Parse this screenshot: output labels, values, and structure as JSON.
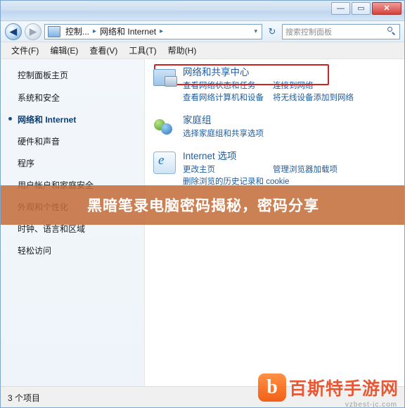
{
  "window": {
    "buttons": {
      "minimize": "—",
      "maximize": "▭",
      "close": "✕"
    }
  },
  "address": {
    "back": "◀",
    "forward": "▶",
    "crumbs": [
      "控制...",
      "网络和 Internet"
    ],
    "separator": "▸",
    "dropdown": "▾",
    "refresh": "↻",
    "search_placeholder": "搜索控制面板",
    "search_icon": "search-icon"
  },
  "menu": {
    "items": [
      "文件(F)",
      "编辑(E)",
      "查看(V)",
      "工具(T)",
      "帮助(H)"
    ]
  },
  "sidebar": {
    "title": "控制面板主页",
    "items": [
      {
        "label": "系统和安全",
        "current": false
      },
      {
        "label": "网络和 Internet",
        "current": true
      },
      {
        "label": "硬件和声音",
        "current": false
      },
      {
        "label": "程序",
        "current": false
      },
      {
        "label": "用户帐户和家庭安全",
        "current": false
      },
      {
        "label": "外观和个性化",
        "current": false
      },
      {
        "label": "时钟、语言和区域",
        "current": false
      },
      {
        "label": "轻松访问",
        "current": false
      }
    ]
  },
  "main": {
    "groups": [
      {
        "icon": "network-sharing-icon",
        "title": "网络和共享中心",
        "links": [
          [
            "查看网络状态和任务",
            "连接到网络"
          ],
          [
            "查看网络计算机和设备",
            "将无线设备添加到网络"
          ]
        ]
      },
      {
        "icon": "homegroup-icon",
        "title": "家庭组",
        "links": [
          [
            "选择家庭组和共享选项",
            ""
          ]
        ]
      },
      {
        "icon": "internet-options-icon",
        "title": "Internet 选项",
        "links": [
          [
            "更改主页",
            "管理浏览器加载项"
          ],
          [
            "删除浏览的历史记录和 cookie",
            ""
          ]
        ]
      }
    ]
  },
  "banner": {
    "text": "黑暗笔录电脑密码揭秘，密码分享"
  },
  "status": {
    "text": "3 个项目"
  },
  "watermark": {
    "logo": "b",
    "text": "百斯特手游网",
    "url": "vzbest-jc.com"
  },
  "colors": {
    "accent": "#1f5da0",
    "highlight_border": "#cf2222",
    "banner_bg": "#c46c38",
    "watermark": "#e8502a"
  }
}
